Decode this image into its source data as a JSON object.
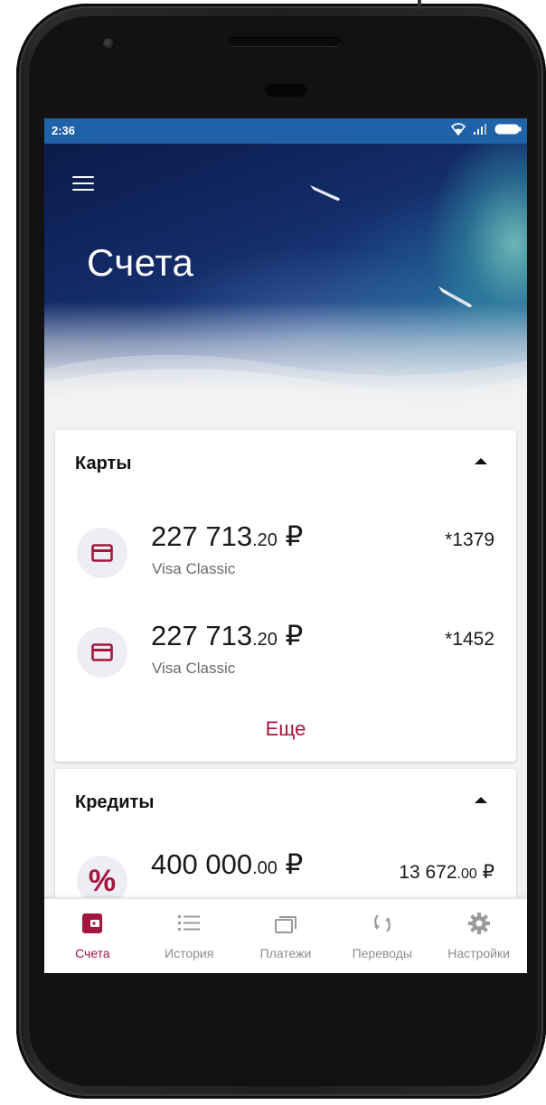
{
  "status_bar": {
    "time": "2:36"
  },
  "header": {
    "title": "Счета"
  },
  "cards_section": {
    "title": "Карты",
    "items": [
      {
        "amount_main": "227 713",
        "amount_cents": ".20",
        "currency": "₽",
        "name": "Visa Classic",
        "number": "*1379"
      },
      {
        "amount_main": "227 713",
        "amount_cents": ".20",
        "currency": "₽",
        "name": "Visa Classic",
        "number": "*1452"
      }
    ],
    "more_label": "Еще"
  },
  "credits_section": {
    "title": "Кредиты",
    "items": [
      {
        "amount_main": "400 000",
        "amount_cents": ".00",
        "currency": "₽",
        "payment_main": "13 672",
        "payment_cents": ".00",
        "payment_currency": "₽"
      }
    ]
  },
  "bottom_nav": {
    "items": [
      {
        "label": "Счета",
        "icon": "wallet-icon",
        "active": true
      },
      {
        "label": "История",
        "icon": "list-icon",
        "active": false
      },
      {
        "label": "Платежи",
        "icon": "cards-icon",
        "active": false
      },
      {
        "label": "Переводы",
        "icon": "sync-icon",
        "active": false
      },
      {
        "label": "Настройки",
        "icon": "gear-icon",
        "active": false
      }
    ]
  },
  "colors": {
    "accent": "#a3163d",
    "status_bar": "#1f62a8",
    "nav_inactive": "#8c8c8c"
  }
}
